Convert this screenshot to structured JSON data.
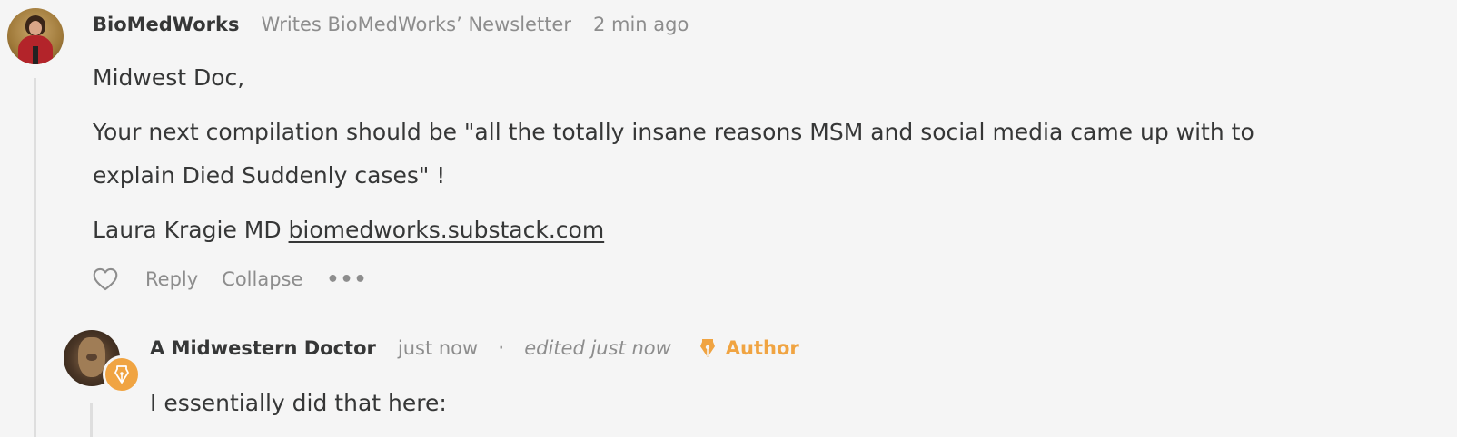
{
  "comments": [
    {
      "author": "BioMedWorks",
      "subtitle": "Writes BioMedWorks’ Newsletter",
      "time": "2 min ago",
      "paragraphs": {
        "p1": "Midwest Doc,",
        "p2": "Your next compilation should be \"all the totally insane reasons MSM and social media came up with to explain Died Suddenly cases\" !",
        "p3_text": "Laura Kragie MD ",
        "p3_link": "biomedworks.substack.com"
      },
      "actions": {
        "reply": "Reply",
        "collapse": "Collapse",
        "more": "•••"
      }
    },
    {
      "author": "A Midwestern Doctor",
      "time": "just now",
      "separator": "·",
      "edited": "edited just now",
      "badge": "Author",
      "paragraphs": {
        "p1": "I essentially did that here:"
      }
    }
  ],
  "colors": {
    "accent": "#f0a442",
    "muted": "#8d8d8d",
    "text": "#363737",
    "background": "#f5f5f5"
  }
}
